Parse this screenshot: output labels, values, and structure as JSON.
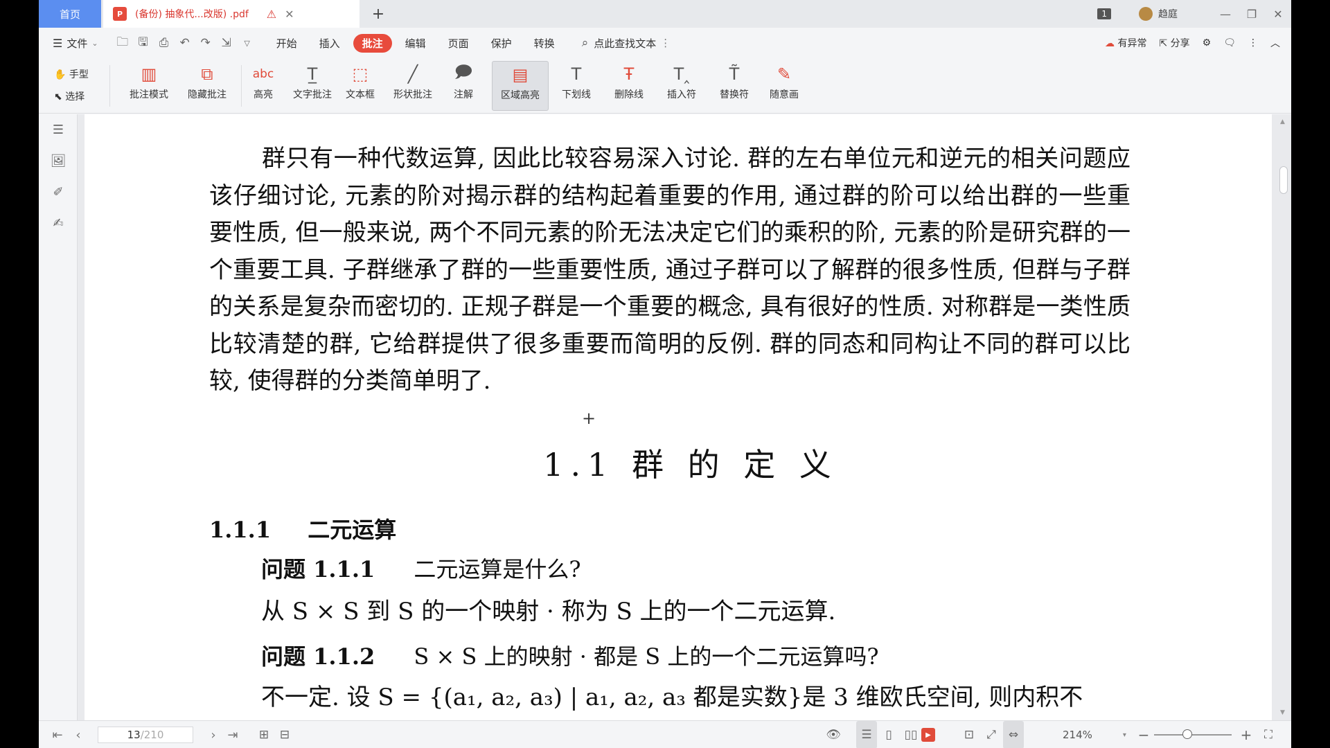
{
  "tabs": {
    "home_label": "首页",
    "doc_label": "(备份) 抽象代...改版) .pdf",
    "page_count_badge": "1",
    "user_name": "趋庭"
  },
  "menu": {
    "file_label": "文件",
    "tabs": [
      "开始",
      "插入",
      "批注",
      "编辑",
      "页面",
      "保护",
      "转换"
    ],
    "active_tab": "批注",
    "search_label": "点此查找文本",
    "sync_label": "有异常",
    "share_label": "分享"
  },
  "ribbon": {
    "hand_label": "手型",
    "select_label": "选择",
    "buttons": [
      {
        "label": "批注模式",
        "icon": "annotation-mode-icon"
      },
      {
        "label": "隐藏批注",
        "icon": "hide-annotation-icon"
      },
      {
        "label": "高亮",
        "icon": "highlight-icon"
      },
      {
        "label": "文字批注",
        "icon": "text-annotation-icon"
      },
      {
        "label": "文本框",
        "icon": "textbox-icon"
      },
      {
        "label": "形状批注",
        "icon": "shape-annotation-icon"
      },
      {
        "label": "注解",
        "icon": "note-icon"
      },
      {
        "label": "区域高亮",
        "icon": "area-highlight-icon"
      },
      {
        "label": "下划线",
        "icon": "underline-icon"
      },
      {
        "label": "删除线",
        "icon": "strikethrough-icon"
      },
      {
        "label": "插入符",
        "icon": "insert-caret-icon"
      },
      {
        "label": "替换符",
        "icon": "replace-caret-icon"
      },
      {
        "label": "随意画",
        "icon": "freehand-pen-icon"
      }
    ],
    "selected": "区域高亮"
  },
  "document": {
    "paragraph": "群只有一种代数运算, 因此比较容易深入讨论. 群的左右单位元和逆元的相关问题应该仔细讨论, 元素的阶对揭示群的结构起着重要的作用, 通过群的阶可以给出群的一些重要性质, 但一般来说, 两个不同元素的阶无法决定它们的乘积的阶, 元素的阶是研究群的一个重要工具. 子群继承了群的一些重要性质, 通过子群可以了解群的很多性质, 但群与子群的关系是复杂而密切的. 正规子群是一个重要的概念, 具有很好的性质. 对称群是一类性质比较清楚的群, 它给群提供了很多重要而简明的反例. 群的同态和同构让不同的群可以比较, 使得群的分类简单明了.",
    "section_title": "1.1 群 的 定 义",
    "subsection_number": "1.1.1",
    "subsection_title": "二元运算",
    "q1_label": "问题 1.1.1",
    "q1_text": "二元运算是什么?",
    "a1_text": "从 S × S 到 S 的一个映射 · 称为 S 上的一个二元运算.",
    "q2_label": "问题 1.1.2",
    "q2_text": "S × S 上的映射 · 都是 S 上的一个二元运算吗?",
    "a2_text": "不一定. 设 S = {(a₁, a₂, a₃) | a₁, a₂, a₃ 都是实数}是 3 维欧氏空间, 则内积不"
  },
  "status": {
    "current_page": "13",
    "total_pages": "/210",
    "zoom": "214%",
    "zoom_fraction": 0.43
  },
  "colors": {
    "accent": "#e84b3c",
    "home_tab": "#5b8ef0"
  }
}
